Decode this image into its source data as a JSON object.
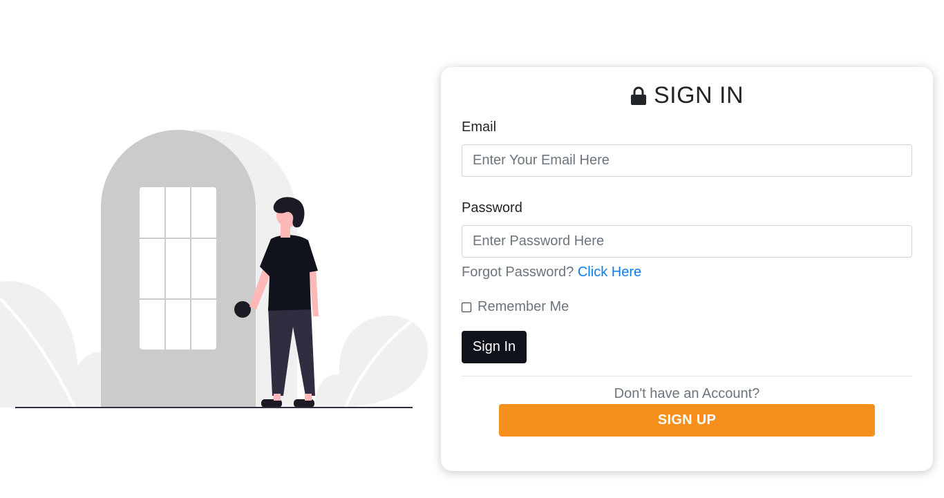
{
  "form": {
    "title": "SIGN IN",
    "title_icon": "lock-icon",
    "email_label": "Email",
    "email_placeholder": "Enter Your Email Here",
    "email_value": "",
    "password_label": "Password",
    "password_placeholder": "Enter Password Here",
    "password_value": "",
    "forgot_text": "Forgot Password?",
    "forgot_link": "Click Here",
    "remember_label": "Remember Me",
    "remember_checked": false,
    "signin_label": "Sign In",
    "no_account_text": "Don't have an Account?",
    "signup_label": "SIGN UP"
  },
  "colors": {
    "signin_button": "#10121c",
    "signup_button": "#f78f1e",
    "link": "#0d7ef0",
    "illustration_door": "#cbcbcb",
    "illustration_foliage": "#f0f0f0"
  }
}
